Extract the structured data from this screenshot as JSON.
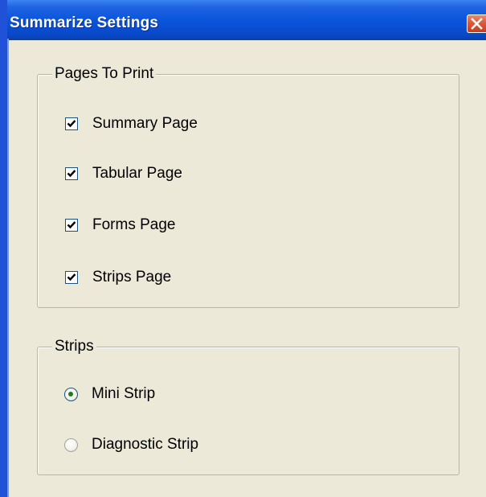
{
  "window": {
    "title": "Summarize Settings"
  },
  "pages_group": {
    "label": "Pages To Print",
    "items": [
      {
        "label": "Summary Page",
        "checked": true
      },
      {
        "label": "Tabular Page",
        "checked": true
      },
      {
        "label": "Forms Page",
        "checked": true
      },
      {
        "label": "Strips Page",
        "checked": true
      }
    ]
  },
  "strips_group": {
    "label": "Strips",
    "options": [
      {
        "label": "Mini Strip",
        "selected": true
      },
      {
        "label": "Diagnostic Strip",
        "selected": false
      }
    ]
  },
  "colors": {
    "titlebar": "#0a55dc",
    "dialog_background": "#ece9d8",
    "close_button": "#d95a3a",
    "radio_dot": "#1e7c1e"
  }
}
